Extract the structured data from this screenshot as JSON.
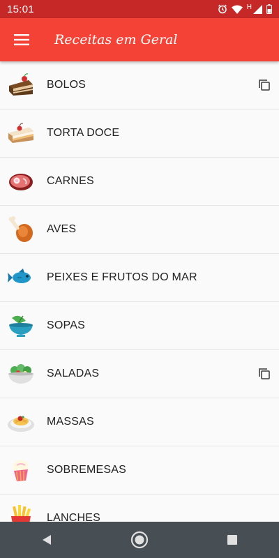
{
  "status": {
    "time": "15:01",
    "network_letter": "H"
  },
  "app": {
    "title": "Receitas em Geral"
  },
  "categories": [
    {
      "label": "BOLOS",
      "icon": "cake-slice-icon",
      "has_copy": true
    },
    {
      "label": "TORTA DOCE",
      "icon": "torte-slice-icon",
      "has_copy": false
    },
    {
      "label": "CARNES",
      "icon": "meat-steak-icon",
      "has_copy": false
    },
    {
      "label": "AVES",
      "icon": "chicken-leg-icon",
      "has_copy": false
    },
    {
      "label": "PEIXES E FRUTOS DO MAR",
      "icon": "fish-icon",
      "has_copy": false
    },
    {
      "label": "SOPAS",
      "icon": "soup-bowl-icon",
      "has_copy": false
    },
    {
      "label": "SALADAS",
      "icon": "salad-bowl-icon",
      "has_copy": true
    },
    {
      "label": "MASSAS",
      "icon": "spaghetti-icon",
      "has_copy": false
    },
    {
      "label": "SOBREMESAS",
      "icon": "cupcake-icon",
      "has_copy": false
    },
    {
      "label": "LANCHES",
      "icon": "fries-icon",
      "has_copy": false
    }
  ],
  "colors": {
    "status_bar": "#c62828",
    "app_bar": "#f44336",
    "nav_bar": "#474f55"
  }
}
